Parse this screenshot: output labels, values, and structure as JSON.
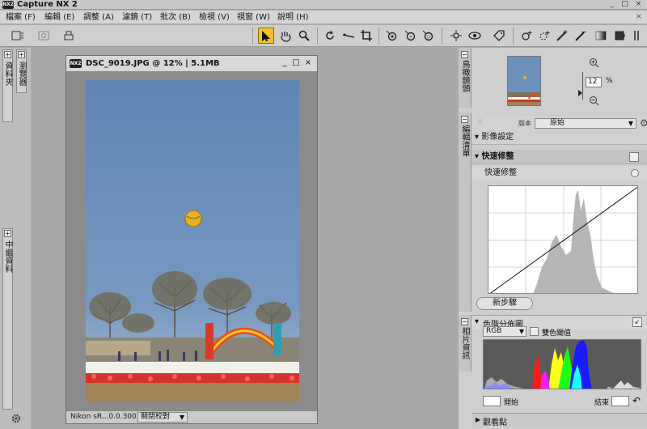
{
  "app": {
    "title": "Capture NX 2",
    "icon_text": "NX2"
  },
  "window_controls": {
    "minimize": "_",
    "maximize": "□",
    "close": "×",
    "menu_close": "×"
  },
  "menu": [
    {
      "label": "檔案 (F)"
    },
    {
      "label": "編輯 (E)"
    },
    {
      "label": "調整 (A)"
    },
    {
      "label": "濾鏡 (T)"
    },
    {
      "label": "批次 (B)"
    },
    {
      "label": "檢視 (V)"
    },
    {
      "label": "視窗 (W)"
    },
    {
      "label": "說明 (H)"
    }
  ],
  "left_dock": {
    "tab1": "資料夾",
    "tab2": "瀏覽器",
    "tab3": "中繼資料"
  },
  "image_window": {
    "title": "DSC_9019.JPG @ 12% | 5.1MB",
    "camera_text": "Nikon sR...0.0.3002",
    "compare_label": "關閉校對"
  },
  "right_panel": {
    "navigator_tab": "鳥瞰鏡頭",
    "zoom_value": "12",
    "zoom_unit": "%",
    "edit_tab": "編輯清單",
    "version_label": "版本",
    "version_value": "原始",
    "image_settings": "影像設定",
    "quick_fix": "快速修整",
    "quick_fix_sub": "快速修整",
    "new_step": "新步驟",
    "photo_info_tab": "相片資訊",
    "histogram_title": "色階分佈圖",
    "channel": "RGB",
    "dual_threshold": "雙色閾值",
    "start_label": "開始",
    "end_label": "結束",
    "watch_points": "觀看點"
  },
  "colors": {
    "toolbar_active": "#f2c12e",
    "sky": "#5f86b3"
  }
}
